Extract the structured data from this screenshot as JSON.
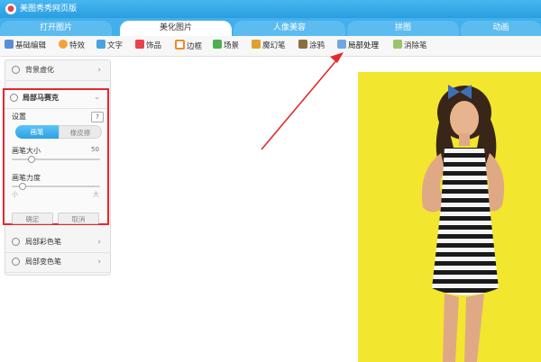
{
  "app": {
    "title": "美图秀秀网页版",
    "logo_icon": "meitu-logo-icon"
  },
  "tabs": [
    {
      "label": "打开图片",
      "active": false
    },
    {
      "label": "美化图片",
      "active": true
    },
    {
      "label": "人像美容",
      "active": false
    },
    {
      "label": "拼图",
      "active": false
    },
    {
      "label": "动画",
      "active": false
    }
  ],
  "toolbar": [
    {
      "label": "基础编辑",
      "icon": "sliders-icon",
      "color": "#5a8fd6"
    },
    {
      "label": "特效",
      "icon": "magic-wand-icon",
      "color": "#f2a23a"
    },
    {
      "label": "文字",
      "icon": "text-icon",
      "color": "#4aa3df"
    },
    {
      "label": "饰品",
      "icon": "bow-icon",
      "color": "#e8434b"
    },
    {
      "label": "边框",
      "icon": "frame-icon",
      "color": "#f08a24"
    },
    {
      "label": "场景",
      "icon": "landscape-icon",
      "color": "#4caf50"
    },
    {
      "label": "魔幻笔",
      "icon": "pen-icon",
      "color": "#e0a030"
    },
    {
      "label": "涂鸦",
      "icon": "brush-icon",
      "color": "#8c6d3f"
    },
    {
      "label": "局部处理",
      "icon": "local-brush-icon",
      "color": "#6fa8dc",
      "active": true
    },
    {
      "label": "消除笔",
      "icon": "eraser-icon",
      "color": "#9bc46b"
    }
  ],
  "sidebar": {
    "items": [
      {
        "label": "背景虚化"
      },
      {
        "label": "局部马赛克"
      },
      {
        "label": "局部彩色笔"
      },
      {
        "label": "局部变色笔"
      }
    ]
  },
  "panel": {
    "settings_label": "设置",
    "help_label": "?",
    "brush_label": "画笔",
    "eraser_label": "橡皮擦",
    "size_label": "画笔大小",
    "size_value": "50",
    "size_level": 0.22,
    "strength_label": "画笔力度",
    "strength_level": 0.12,
    "strength_min_label": "小",
    "strength_max_label": "大",
    "confirm_label": "确定",
    "cancel_label": "取消"
  },
  "colors": {
    "accent": "#2a9ee0",
    "highlight": "#e5282e",
    "photo_bg": "#f2e62e"
  }
}
